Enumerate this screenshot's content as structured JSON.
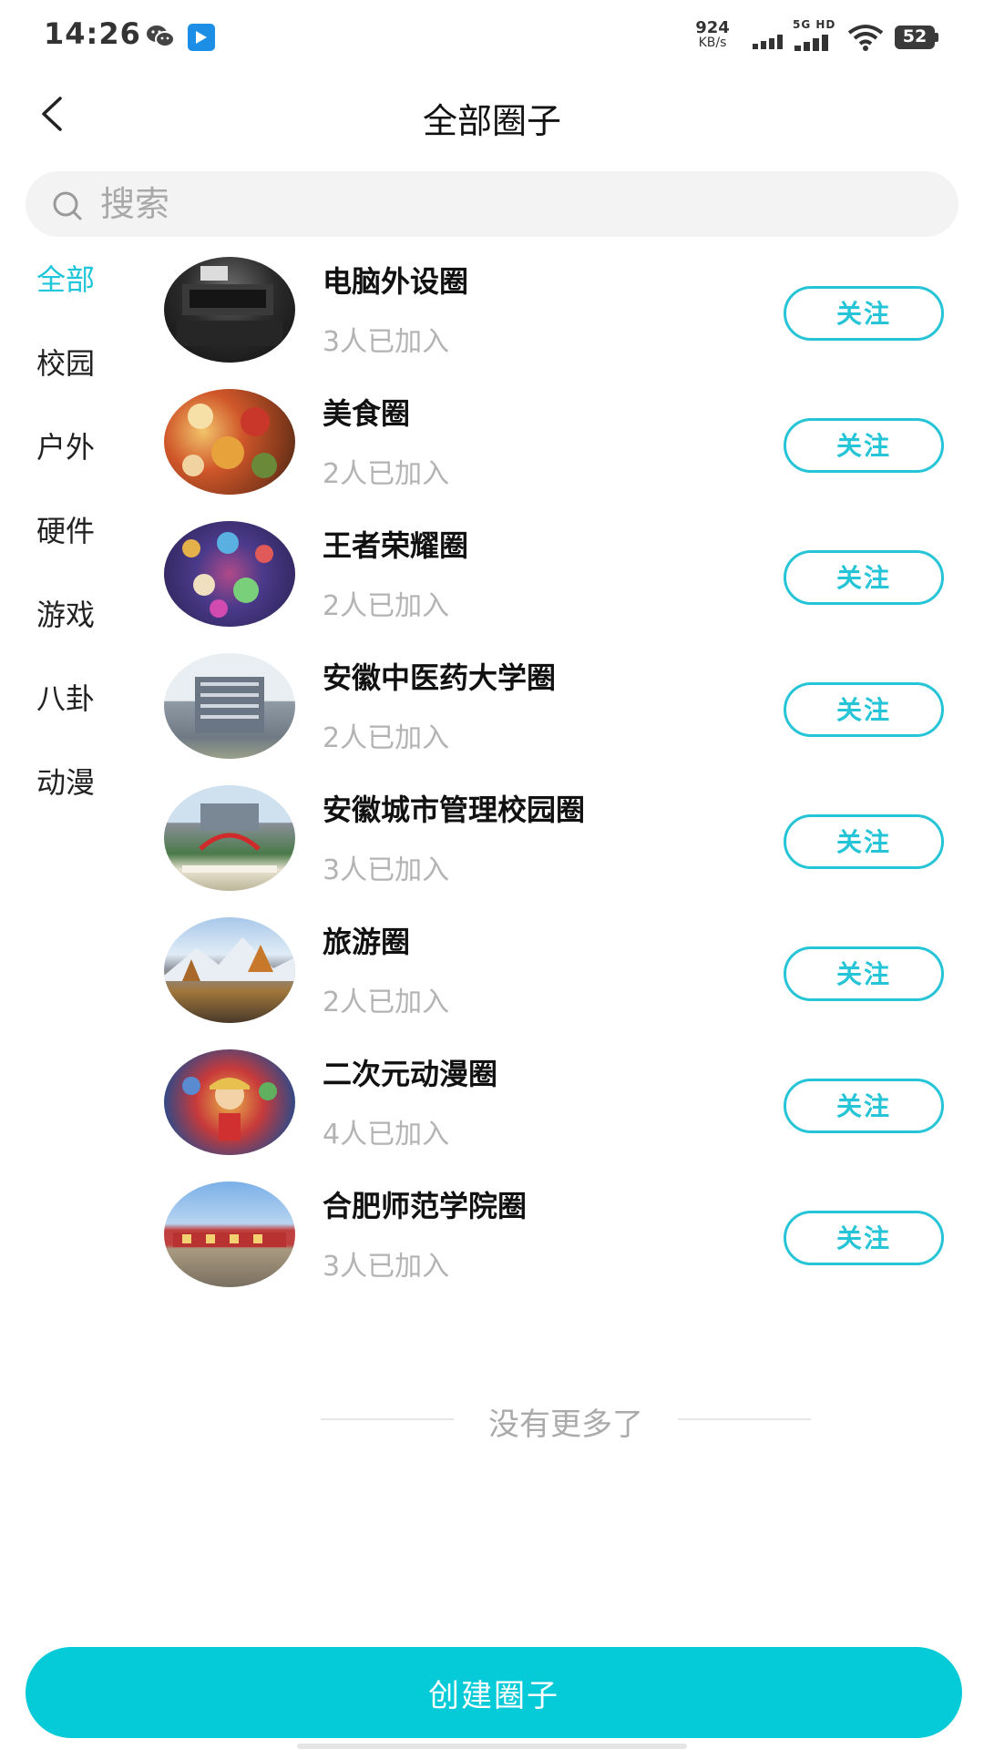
{
  "status_bar": {
    "time": "14:26",
    "speed_value": "924",
    "speed_unit": "KB/s",
    "network_tag": "5G HD",
    "battery": "52",
    "battery_level_percent": 52
  },
  "header": {
    "title": "全部圈子"
  },
  "search": {
    "placeholder": "搜索"
  },
  "categories": [
    {
      "label": "全部",
      "active": true
    },
    {
      "label": "校园",
      "active": false
    },
    {
      "label": "户外",
      "active": false
    },
    {
      "label": "硬件",
      "active": false
    },
    {
      "label": "游戏",
      "active": false
    },
    {
      "label": "八卦",
      "active": false
    },
    {
      "label": "动漫",
      "active": false
    }
  ],
  "circles": [
    {
      "name": "电脑外设圈",
      "members": "3人已加入",
      "follow_label": "关注"
    },
    {
      "name": "美食圈",
      "members": "2人已加入",
      "follow_label": "关注"
    },
    {
      "name": "王者荣耀圈",
      "members": "2人已加入",
      "follow_label": "关注"
    },
    {
      "name": "安徽中医药大学圈",
      "members": "2人已加入",
      "follow_label": "关注"
    },
    {
      "name": "安徽城市管理校园圈",
      "members": "3人已加入",
      "follow_label": "关注"
    },
    {
      "name": "旅游圈",
      "members": "2人已加入",
      "follow_label": "关注"
    },
    {
      "name": "二次元动漫圈",
      "members": "4人已加入",
      "follow_label": "关注"
    },
    {
      "name": "合肥师范学院圈",
      "members": "3人已加入",
      "follow_label": "关注"
    }
  ],
  "list_end_text": "没有更多了",
  "create_button_label": "创建圈子",
  "colors": {
    "accent": "#1cc5d8",
    "primary_button": "#05cad8",
    "muted_text": "#b3b3b3"
  },
  "icons": [
    "back-icon",
    "search-icon",
    "wechat-icon",
    "signal-icon",
    "wifi-icon",
    "battery-icon"
  ]
}
